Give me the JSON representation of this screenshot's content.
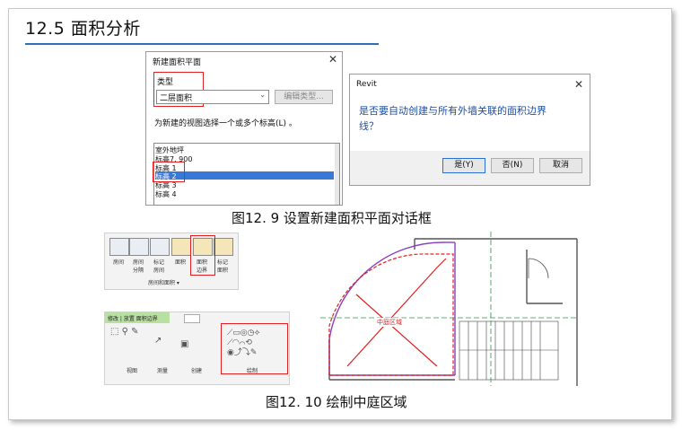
{
  "page": {
    "heading": "12.5  面积分析",
    "caption_fig9": "图12. 9  设置新建面积平面对话框",
    "caption_fig10": "图12. 10  绘制中庭区域"
  },
  "dialog_new_area_plan": {
    "title": "新建面积平面",
    "type_label": "类型",
    "type_value": "二层面积",
    "edit_type_button": "编辑类型...",
    "prompt": "为新建的视图选择一个或多个标高(L) 。",
    "levels": [
      "室外地坪",
      "标高7. 900",
      "标高 1",
      "标高 2",
      "标高 3",
      "标高 4"
    ],
    "selected_level": "标高 2"
  },
  "dialog_revit": {
    "title": "Revit",
    "message_line1": "是否要自动创建与所有外墙关联的面积边界",
    "message_line2": "线？",
    "yes_button": "是(Y)",
    "no_button": "否(N)",
    "cancel_button": "取消"
  },
  "ribbon_room_area": {
    "buttons": [
      {
        "label": "房间",
        "icon": "room-icon"
      },
      {
        "label": "房间\n分隔",
        "icon": "room-separator-icon"
      },
      {
        "label": "标记\n房间",
        "icon": "tag-room-icon"
      },
      {
        "label": "面积",
        "icon": "area-icon"
      },
      {
        "label": "面积\n边界",
        "icon": "area-boundary-icon"
      },
      {
        "label": "标记\n面积",
        "icon": "tag-area-icon"
      }
    ],
    "panel_label": "房间和面积 ▾"
  },
  "ribbon_modify": {
    "context_tab": "修改 | 放置 面积边界",
    "panels": [
      "视图",
      "测量",
      "创建",
      "绘制"
    ]
  },
  "drawing": {
    "zone_label": "中庭区域"
  },
  "colors": {
    "accent_rule": "#2e6fb5",
    "highlight_red": "#e02020",
    "selection_blue": "#3a78d8"
  }
}
